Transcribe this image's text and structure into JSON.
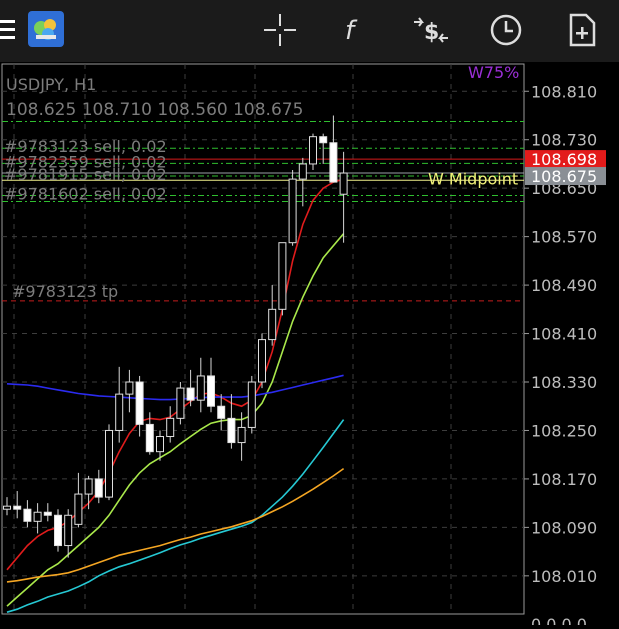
{
  "toolbar": {
    "icons": [
      "menu-icon",
      "metatrader-logo-icon",
      "crosshair-icon",
      "indicators-f-icon",
      "trade-dollar-arrows-icon",
      "clock-timeframe-icon",
      "new-document-icon"
    ]
  },
  "chart_data": {
    "type": "candlestick",
    "symbol_label": "USDJPY, H1",
    "ohlc_label": "108.625 108.710 108.560 108.675",
    "indicator_label": "W75%",
    "price_axis": {
      "ticks": [
        "108.810",
        "108.730",
        "108.650",
        "108.570",
        "108.490",
        "108.410",
        "108.330",
        "108.250",
        "108.170",
        "108.090",
        "108.010"
      ],
      "min": 107.947,
      "max": 108.855,
      "bottom_partial": "0.0.0.0"
    },
    "price_tags": [
      {
        "value": "108.698",
        "bg": "#e31b1b",
        "fg": "#ffffff"
      },
      {
        "value": "108.675",
        "bg": "#8a8f95",
        "fg": "#ffffff"
      }
    ],
    "order_lines": [
      {
        "label": "#9783123 sell, 0.02",
        "price": 108.716
      },
      {
        "label": "#9782359 sell, 0.02",
        "price": 108.691
      },
      {
        "label": "#9781915 sell, 0.02",
        "price": 108.67
      },
      {
        "label": "#9781602 sell, 0.02",
        "price": 108.638
      }
    ],
    "tp_line": {
      "label": "#9783123 tp",
      "price": 108.464
    },
    "midpoint": {
      "label": "W Midpoint",
      "price": 108.663
    },
    "candles": [
      {
        "o": 108.12,
        "h": 108.14,
        "l": 108.11,
        "c": 108.125
      },
      {
        "o": 108.125,
        "h": 108.15,
        "l": 108.105,
        "c": 108.12
      },
      {
        "o": 108.12,
        "h": 108.135,
        "l": 108.09,
        "c": 108.1
      },
      {
        "o": 108.1,
        "h": 108.13,
        "l": 108.08,
        "c": 108.115
      },
      {
        "o": 108.115,
        "h": 108.13,
        "l": 108.1,
        "c": 108.11
      },
      {
        "o": 108.11,
        "h": 108.12,
        "l": 108.05,
        "c": 108.06
      },
      {
        "o": 108.06,
        "h": 108.12,
        "l": 108.04,
        "c": 108.11
      },
      {
        "o": 108.095,
        "h": 108.18,
        "l": 108.09,
        "c": 108.145
      },
      {
        "o": 108.145,
        "h": 108.175,
        "l": 108.12,
        "c": 108.17
      },
      {
        "o": 108.17,
        "h": 108.185,
        "l": 108.13,
        "c": 108.14
      },
      {
        "o": 108.14,
        "h": 108.26,
        "l": 108.135,
        "c": 108.25
      },
      {
        "o": 108.25,
        "h": 108.355,
        "l": 108.23,
        "c": 108.31
      },
      {
        "o": 108.31,
        "h": 108.35,
        "l": 108.28,
        "c": 108.33
      },
      {
        "o": 108.33,
        "h": 108.34,
        "l": 108.24,
        "c": 108.26
      },
      {
        "o": 108.26,
        "h": 108.28,
        "l": 108.21,
        "c": 108.215
      },
      {
        "o": 108.215,
        "h": 108.25,
        "l": 108.2,
        "c": 108.24
      },
      {
        "o": 108.24,
        "h": 108.29,
        "l": 108.23,
        "c": 108.27
      },
      {
        "o": 108.27,
        "h": 108.33,
        "l": 108.26,
        "c": 108.32
      },
      {
        "o": 108.32,
        "h": 108.35,
        "l": 108.29,
        "c": 108.3
      },
      {
        "o": 108.3,
        "h": 108.37,
        "l": 108.28,
        "c": 108.34
      },
      {
        "o": 108.34,
        "h": 108.37,
        "l": 108.28,
        "c": 108.29
      },
      {
        "o": 108.29,
        "h": 108.31,
        "l": 108.25,
        "c": 108.27
      },
      {
        "o": 108.27,
        "h": 108.31,
        "l": 108.22,
        "c": 108.23
      },
      {
        "o": 108.23,
        "h": 108.28,
        "l": 108.2,
        "c": 108.255
      },
      {
        "o": 108.255,
        "h": 108.34,
        "l": 108.245,
        "c": 108.33
      },
      {
        "o": 108.33,
        "h": 108.41,
        "l": 108.32,
        "c": 108.4
      },
      {
        "o": 108.4,
        "h": 108.49,
        "l": 108.39,
        "c": 108.45
      },
      {
        "o": 108.45,
        "h": 108.56,
        "l": 108.44,
        "c": 108.56
      },
      {
        "o": 108.56,
        "h": 108.68,
        "l": 108.555,
        "c": 108.665
      },
      {
        "o": 108.665,
        "h": 108.7,
        "l": 108.62,
        "c": 108.69
      },
      {
        "o": 108.69,
        "h": 108.74,
        "l": 108.68,
        "c": 108.735
      },
      {
        "o": 108.735,
        "h": 108.74,
        "l": 108.69,
        "c": 108.725
      },
      {
        "o": 108.725,
        "h": 108.77,
        "l": 108.69,
        "c": 108.66
      },
      {
        "o": 108.64,
        "h": 108.71,
        "l": 108.56,
        "c": 108.675
      }
    ],
    "moving_averages": [
      {
        "color": "#e01c1c",
        "values": [
          108.02,
          108.04,
          108.06,
          108.075,
          108.085,
          108.09,
          108.1,
          108.115,
          108.13,
          108.15,
          108.18,
          108.215,
          108.245,
          108.265,
          108.27,
          108.268,
          108.272,
          108.285,
          108.298,
          108.31,
          108.312,
          108.305,
          108.295,
          108.29,
          108.3,
          108.33,
          108.38,
          108.45,
          108.53,
          108.59,
          108.63,
          108.65,
          108.66,
          108.665
        ]
      },
      {
        "color": "#a9e84b",
        "values": [
          107.96,
          107.975,
          107.99,
          108.005,
          108.02,
          108.03,
          108.045,
          108.06,
          108.075,
          108.09,
          108.11,
          108.135,
          108.16,
          108.18,
          108.195,
          108.205,
          108.215,
          108.228,
          108.24,
          108.252,
          108.262,
          108.266,
          108.268,
          108.268,
          108.275,
          108.295,
          108.33,
          108.38,
          108.43,
          108.47,
          108.505,
          108.535,
          108.555,
          108.575
        ]
      },
      {
        "color": "#2b2bf0",
        "values": [
          108.327,
          108.326,
          108.325,
          108.323,
          108.32,
          108.317,
          108.314,
          108.311,
          108.309,
          108.307,
          108.306,
          108.305,
          108.304,
          108.303,
          108.302,
          108.301,
          108.301,
          108.302,
          108.303,
          108.304,
          108.305,
          108.305,
          108.305,
          108.305,
          108.307,
          108.31,
          108.313,
          108.317,
          108.321,
          108.325,
          108.329,
          108.333,
          108.337,
          108.341
        ]
      },
      {
        "color": "#26c9d4",
        "values": [
          107.95,
          107.955,
          107.962,
          107.968,
          107.975,
          107.98,
          107.985,
          107.992,
          108.0,
          108.01,
          108.018,
          108.025,
          108.03,
          108.036,
          108.042,
          108.048,
          108.055,
          108.061,
          108.066,
          108.072,
          108.077,
          108.082,
          108.087,
          108.092,
          108.098,
          108.11,
          108.125,
          108.14,
          108.158,
          108.178,
          108.2,
          108.222,
          108.245,
          108.268
        ]
      },
      {
        "color": "#f5a623",
        "values": [
          108.0,
          108.002,
          108.005,
          108.008,
          108.01,
          108.012,
          108.015,
          108.02,
          108.026,
          108.032,
          108.038,
          108.044,
          108.048,
          108.052,
          108.056,
          108.06,
          108.065,
          108.07,
          108.074,
          108.079,
          108.083,
          108.087,
          108.091,
          108.096,
          108.101,
          108.108,
          108.116,
          108.124,
          108.133,
          108.143,
          108.153,
          108.164,
          108.175,
          108.187
        ]
      }
    ],
    "grid": true
  }
}
